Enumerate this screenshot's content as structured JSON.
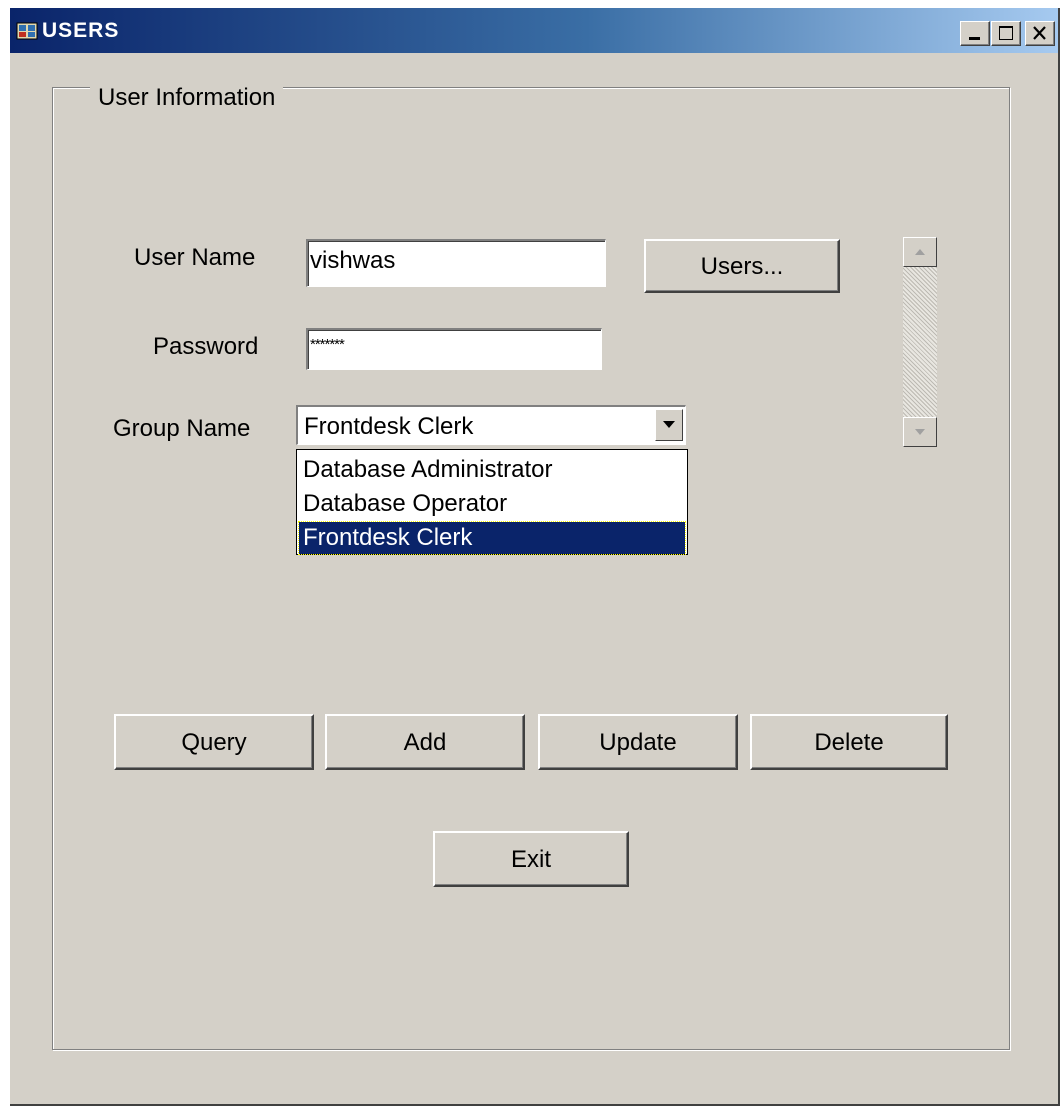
{
  "window": {
    "title": "USERS",
    "controls": [
      "minimize-icon",
      "maximize-icon",
      "close-icon"
    ]
  },
  "groupbox": {
    "label": "User Information"
  },
  "form": {
    "user_name_label": "User Name",
    "user_name_value": "vishwas",
    "password_label": "Password",
    "password_value": "*******",
    "group_name_label": "Group Name",
    "group_name_value": "Frontdesk Clerk",
    "group_options": [
      "Database Administrator",
      "Database Operator",
      "Frontdesk Clerk"
    ],
    "selected_option": "Frontdesk Clerk"
  },
  "buttons": {
    "users": "Users...",
    "query": "Query",
    "add": "Add",
    "update": "Update",
    "delete": "Delete",
    "exit": "Exit"
  },
  "colors": {
    "face": "#d4d0c8",
    "title_start": "#0a246a",
    "title_end": "#a6caf0",
    "selection": "#0a246a"
  }
}
